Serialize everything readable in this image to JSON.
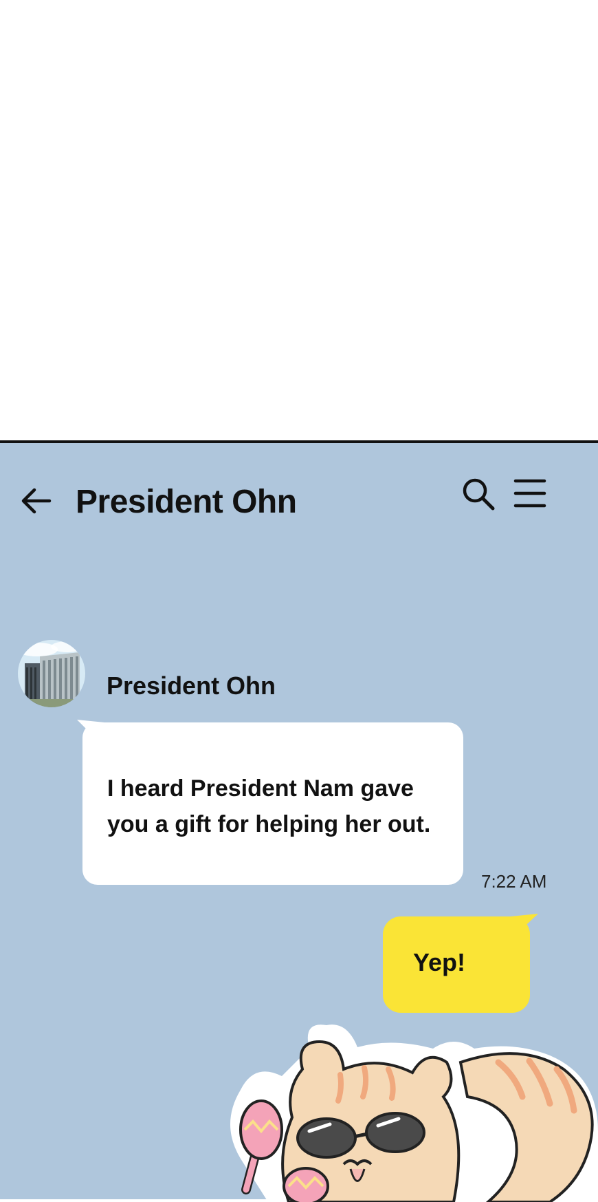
{
  "header": {
    "back": "back-arrow-icon",
    "title": "President Ohn",
    "search": "search-icon",
    "menu": "menu-icon"
  },
  "messages": [
    {
      "direction": "incoming",
      "sender": "President Ohn",
      "avatar": "building-avatar",
      "text": "I heard President Nam gave you a gift for helping her out.",
      "time": "7:22 AM"
    },
    {
      "direction": "outgoing",
      "text": "Yep!"
    }
  ],
  "sticker": {
    "name": "squirrel-sunglasses-maracas-sticker"
  },
  "colors": {
    "chat_background": "#afc6dc",
    "incoming_bubble": "#ffffff",
    "outgoing_bubble": "#fae436",
    "text": "#111111"
  }
}
